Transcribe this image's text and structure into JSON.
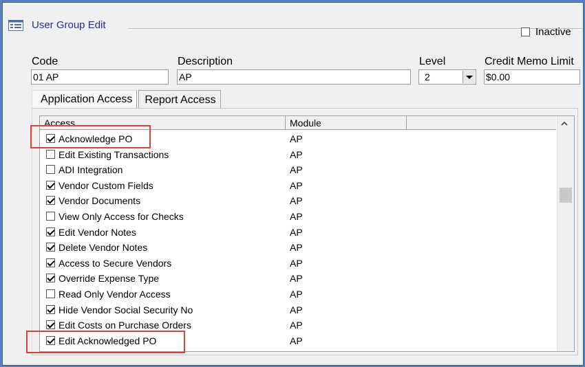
{
  "header": {
    "title": "User Group Edit",
    "icon": "form-icon"
  },
  "inactive": {
    "label": "Inactive",
    "checked": false
  },
  "fields": {
    "code": {
      "label": "Code",
      "value": "01 AP"
    },
    "description": {
      "label": "Description",
      "value": "AP"
    },
    "level": {
      "label": "Level",
      "value": "2"
    },
    "credit_memo_limit": {
      "label": "Credit Memo Limit",
      "value": "$0.00"
    }
  },
  "tabs": [
    {
      "label": "Application Access",
      "active": true
    },
    {
      "label": "Report Access",
      "active": false
    }
  ],
  "grid": {
    "columns": [
      "Access",
      "Module",
      ""
    ],
    "rows": [
      {
        "name": "Acknowledge PO",
        "module": "AP",
        "checked": true
      },
      {
        "name": "Edit Existing Transactions",
        "module": "AP",
        "checked": false
      },
      {
        "name": "ADI Integration",
        "module": "AP",
        "checked": false
      },
      {
        "name": "Vendor Custom Fields",
        "module": "AP",
        "checked": true
      },
      {
        "name": "Vendor Documents",
        "module": "AP",
        "checked": true
      },
      {
        "name": "View Only Access for Checks",
        "module": "AP",
        "checked": false
      },
      {
        "name": "Edit Vendor Notes",
        "module": "AP",
        "checked": true
      },
      {
        "name": "Delete Vendor Notes",
        "module": "AP",
        "checked": true
      },
      {
        "name": "Access to Secure Vendors",
        "module": "AP",
        "checked": true
      },
      {
        "name": "Override Expense Type",
        "module": "AP",
        "checked": true
      },
      {
        "name": "Read Only Vendor Access",
        "module": "AP",
        "checked": false
      },
      {
        "name": "Hide Vendor Social Security No",
        "module": "AP",
        "checked": true
      },
      {
        "name": "Edit Costs on Purchase Orders",
        "module": "AP",
        "checked": true
      },
      {
        "name": "Edit Acknowledged PO",
        "module": "AP",
        "checked": true
      }
    ]
  },
  "colors": {
    "title": "#2a2a9a",
    "highlight": "#e0403a",
    "window_border": "#5b7fb8"
  }
}
